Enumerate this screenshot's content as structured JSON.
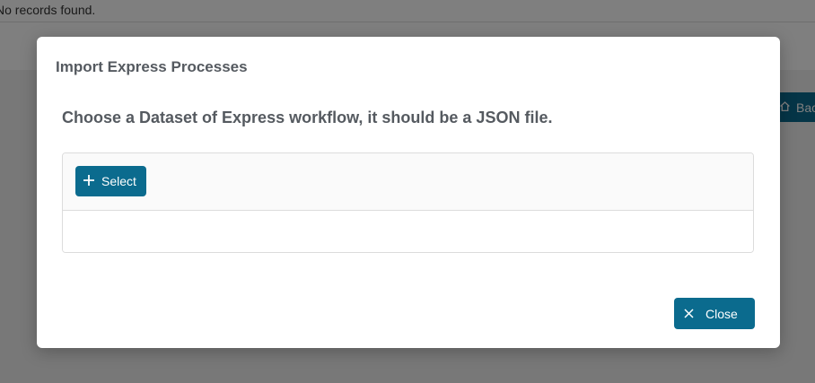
{
  "background": {
    "no_records_text": "No records found.",
    "back_button_label": "Back",
    "back_icon": "home-icon"
  },
  "modal": {
    "title": "Import Express Processes",
    "subtitle": "Choose a Dataset of Express workflow, it should be a JSON file.",
    "select_button_label": "Select",
    "select_icon": "plus-icon",
    "close_button_label": "Close",
    "close_icon": "close-icon"
  },
  "colors": {
    "accent": "#0b6b8e",
    "overlay": "rgba(0,0,0,0.5)",
    "text": "#555a60"
  }
}
